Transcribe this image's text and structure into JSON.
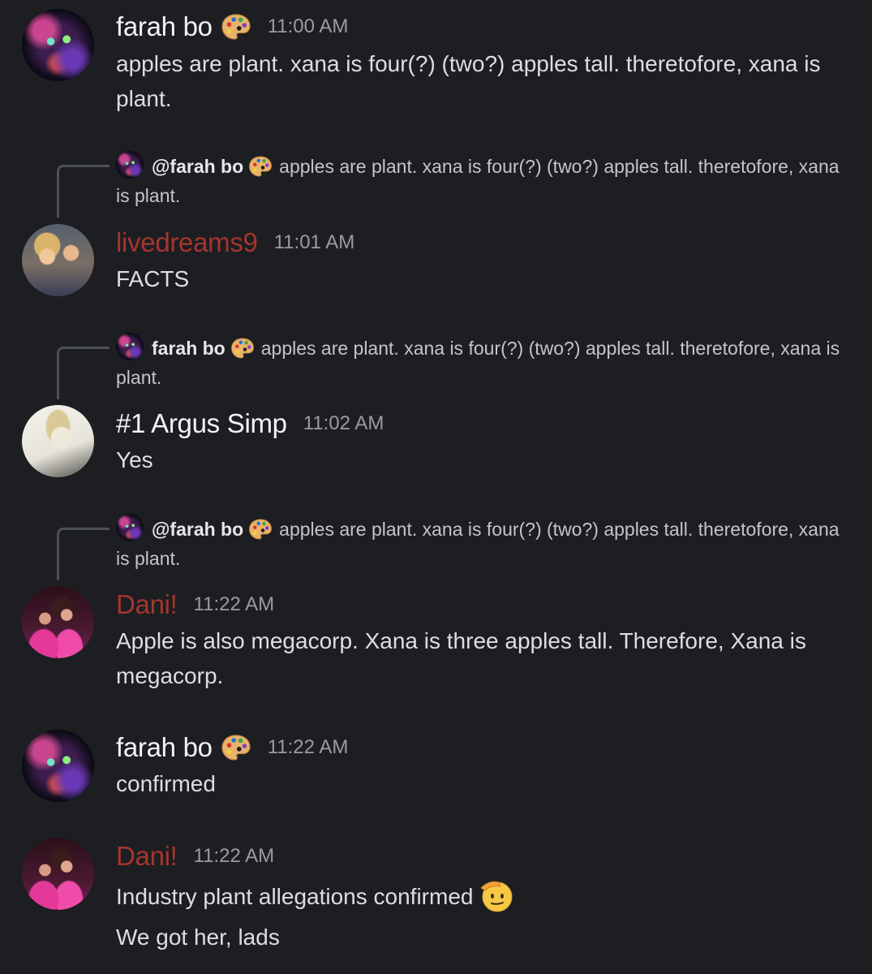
{
  "messages": [
    {
      "author": "farah bo",
      "author_emoji": "artist-palette-icon",
      "time": "11:00 AM",
      "lines": [
        "apples are plant. xana is four(?) (two?) apples tall. theretofore, xana is plant."
      ]
    },
    {
      "reply": {
        "author": "@farah bo",
        "author_emoji": "artist-palette-icon",
        "text": "apples are plant. xana is four(?) (two?) apples tall. theretofore, xana is plant."
      },
      "author": "livedreams9",
      "author_color": "#a5352d",
      "time": "11:01 AM",
      "lines": [
        "FACTS"
      ]
    },
    {
      "reply": {
        "author": "farah bo",
        "author_emoji": "artist-palette-icon",
        "text": "apples are plant. xana is four(?) (two?) apples tall. theretofore, xana is plant."
      },
      "author": "#1 Argus Simp",
      "time": "11:02 AM",
      "lines": [
        "Yes"
      ]
    },
    {
      "reply": {
        "author": "@farah bo",
        "author_emoji": "artist-palette-icon",
        "text": "apples are plant. xana is four(?) (two?) apples tall. theretofore, xana is plant."
      },
      "author": "Dani!",
      "author_color": "#a5352d",
      "time": "11:22 AM",
      "lines": [
        "Apple is also megacorp. Xana is three apples tall. Therefore, Xana is megacorp."
      ]
    },
    {
      "author": "farah bo",
      "author_emoji": "artist-palette-icon",
      "time": "11:22 AM",
      "lines": [
        "confirmed"
      ]
    },
    {
      "author": "Dani!",
      "author_color": "#a5352d",
      "time": "11:22 AM",
      "lines": [
        "Industry plant allegations confirmed",
        "We got her, lads"
      ],
      "trailing_emoji": "saluting-face-icon"
    }
  ],
  "colors": {
    "background": "#1d1e22",
    "text": "#dcdee1",
    "timestamp": "#9a9ca3",
    "red_name": "#a5352d"
  }
}
